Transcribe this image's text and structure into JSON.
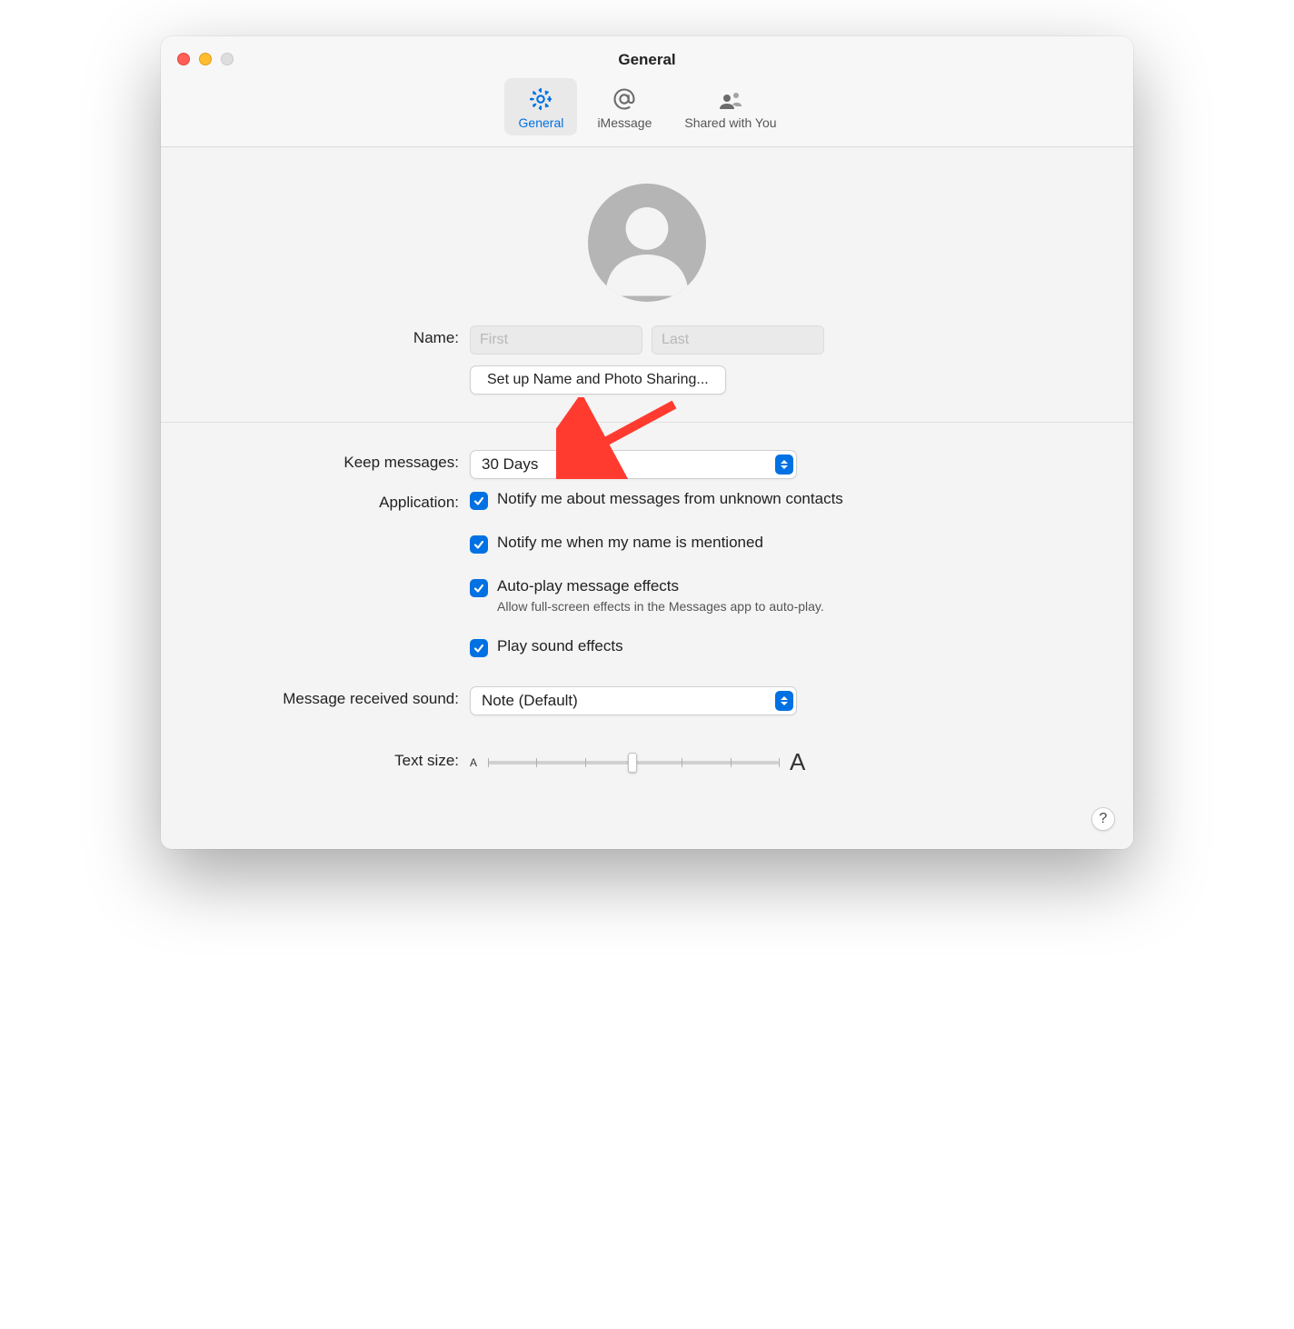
{
  "window": {
    "title": "General"
  },
  "tabs": [
    {
      "label": "General",
      "icon": "gear-icon",
      "selected": true
    },
    {
      "label": "iMessage",
      "icon": "at-icon",
      "selected": false
    },
    {
      "label": "Shared with You",
      "icon": "people-icon",
      "selected": false
    }
  ],
  "name_section": {
    "label": "Name:",
    "first_placeholder": "First",
    "last_placeholder": "Last",
    "setup_button": "Set up Name and Photo Sharing..."
  },
  "keep_messages": {
    "label": "Keep messages:",
    "value": "30 Days"
  },
  "application": {
    "label": "Application:",
    "options": [
      {
        "label": "Notify me about messages from unknown contacts",
        "checked": true,
        "subtext": null
      },
      {
        "label": "Notify me when my name is mentioned",
        "checked": true,
        "subtext": null
      },
      {
        "label": "Auto-play message effects",
        "checked": true,
        "subtext": "Allow full-screen effects in the Messages app to auto-play."
      },
      {
        "label": "Play sound effects",
        "checked": true,
        "subtext": null
      }
    ]
  },
  "sound": {
    "label": "Message received sound:",
    "value": "Note (Default)"
  },
  "text_size": {
    "label": "Text size:",
    "min_label": "A",
    "max_label": "A"
  },
  "help_label": "?"
}
